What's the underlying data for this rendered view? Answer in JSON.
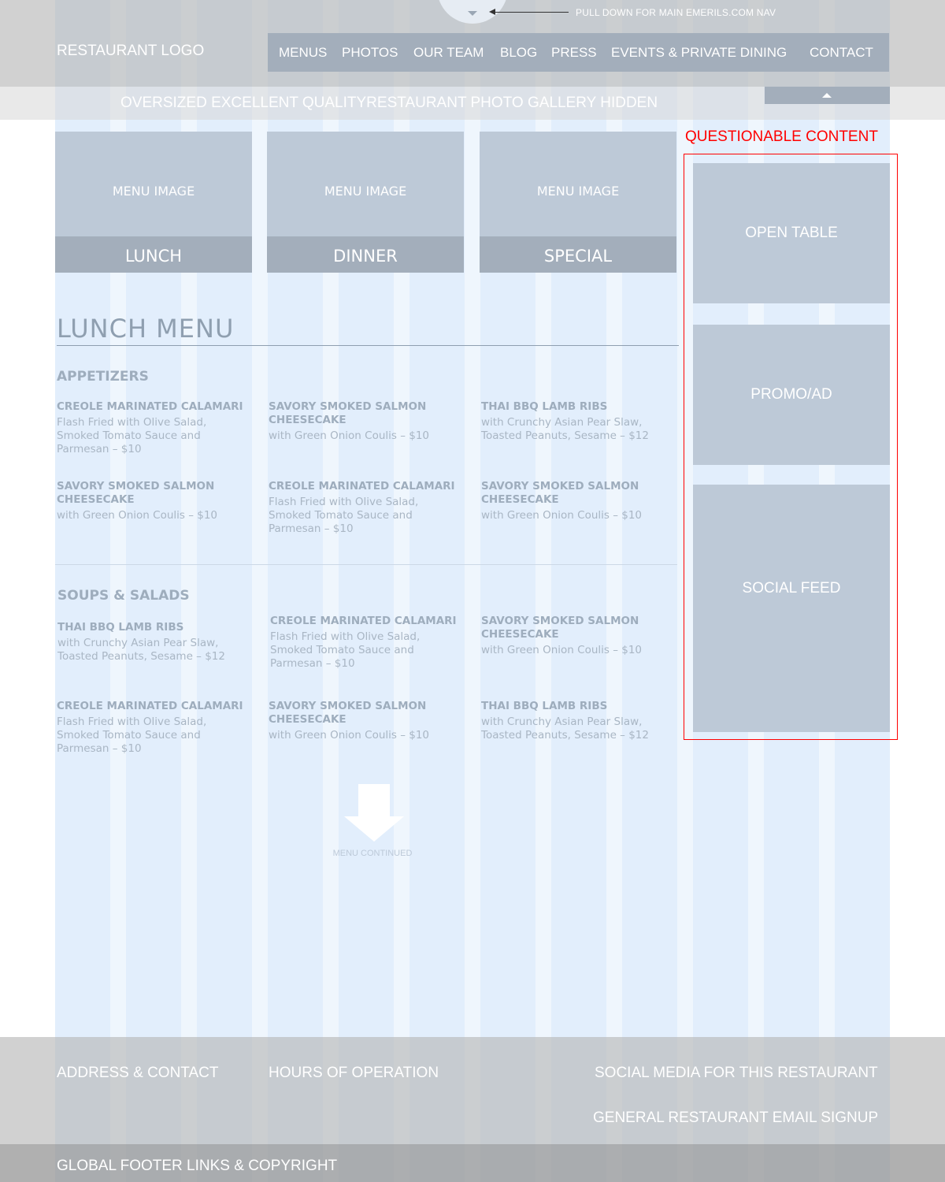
{
  "header": {
    "pull_down_text": "PULL DOWN FOR MAIN EMERILS.COM NAV",
    "logo": "RESTAURANT LOGO",
    "nav": [
      "MENUS",
      "PHOTOS",
      "OUR TEAM",
      "BLOG",
      "PRESS",
      "EVENTS & PRIVATE DINING",
      "CONTACT"
    ]
  },
  "gallery": {
    "text": "OVERSIZED EXCELLENT QUALITYRESTAURANT PHOTO GALLERY HIDDEN"
  },
  "menu_cards": [
    {
      "image_label": "MENU IMAGE",
      "label": "LUNCH"
    },
    {
      "image_label": "MENU IMAGE",
      "label": "DINNER"
    },
    {
      "image_label": "MENU IMAGE",
      "label": "SPECIAL"
    }
  ],
  "lunch_menu": {
    "title": "LUNCH MENU",
    "appetizers": {
      "heading": "APPETIZERS",
      "items": [
        {
          "name": "CREOLE MARINATED CALAMARI",
          "desc": "Flash Fried with Olive Salad, Smoked Tomato Sauce and Parmesan – $10"
        },
        {
          "name": "SAVORY SMOKED SALMON CHEESECAKE",
          "desc": "with Green Onion Coulis – $10"
        },
        {
          "name": "THAI BBQ LAMB RIBS",
          "desc": "with Crunchy Asian Pear Slaw, Toasted Peanuts, Sesame – $12"
        },
        {
          "name": "SAVORY SMOKED SALMON CHEESECAKE",
          "desc": "with Green Onion Coulis – $10"
        },
        {
          "name": "CREOLE MARINATED CALAMARI",
          "desc": "Flash Fried with Olive Salad, Smoked Tomato Sauce and Parmesan – $10"
        },
        {
          "name": "SAVORY SMOKED SALMON CHEESECAKE",
          "desc": "with Green Onion Coulis – $10"
        }
      ]
    },
    "soups_salads": {
      "heading": "SOUPS & SALADS",
      "items": [
        {
          "name": "THAI BBQ LAMB RIBS",
          "desc": "with Crunchy Asian Pear Slaw, Toasted Peanuts, Sesame – $12"
        },
        {
          "name": "CREOLE MARINATED CALAMARI",
          "desc": "Flash Fried with Olive Salad, Smoked Tomato Sauce and Parmesan – $10"
        },
        {
          "name": "SAVORY SMOKED SALMON CHEESECAKE",
          "desc": "with Green Onion Coulis – $10"
        },
        {
          "name": "CREOLE MARINATED CALAMARI",
          "desc": "Flash Fried with Olive Salad, Smoked Tomato Sauce and Parmesan – $10"
        },
        {
          "name": "SAVORY SMOKED SALMON CHEESECAKE",
          "desc": "with Green Onion Coulis – $10"
        },
        {
          "name": "THAI BBQ LAMB RIBS",
          "desc": "with Crunchy Asian Pear Slaw, Toasted Peanuts, Sesame – $12"
        }
      ]
    },
    "continued_label": "MENU CONTINUED"
  },
  "sidebar": {
    "label": "QUESTIONABLE CONTENT",
    "boxes": [
      "OPEN TABLE",
      "PROMO/AD",
      "SOCIAL FEED"
    ]
  },
  "footer": {
    "address": "ADDRESS & CONTACT",
    "hours": "HOURS OF OPERATION",
    "social": "SOCIAL MEDIA FOR THIS RESTAURANT",
    "email_signup": "GENERAL RESTAURANT EMAIL SIGNUP",
    "global": "GLOBAL FOOTER LINKS & COPYRIGHT"
  },
  "colors": {
    "grid_bg": "#e2eefc",
    "nav_bg": "#a3aebb",
    "placeholder_box": "#bdc9d7",
    "text_muted": "#9eadbd",
    "alert_red": "#ff0000"
  }
}
